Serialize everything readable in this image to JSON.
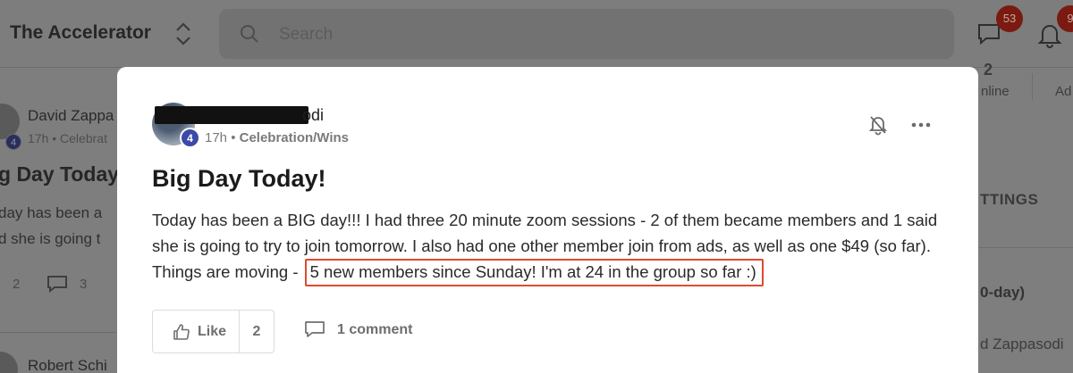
{
  "app": {
    "title": "The Accelerator"
  },
  "search": {
    "placeholder": "Search"
  },
  "header": {
    "chat_badge": "53",
    "notif_badge": "9"
  },
  "background_feed": {
    "post1": {
      "author": "David Zappa",
      "level": "4",
      "meta": "17h • Celebrat",
      "title": "g Day Today!",
      "body_lines": [
        "day has been a",
        "d she is going t"
      ],
      "likes": "2",
      "comments": "3"
    },
    "post2": {
      "author": "Robert Schi"
    }
  },
  "right_sidebar": {
    "stat_value": "2",
    "online_label": "nline",
    "admin_label": "Ad",
    "settings_label": "TTINGS",
    "challenge_label": "0-day)",
    "author_label": "d Zappasodi"
  },
  "post": {
    "author_suffix": "odi",
    "level": "4",
    "time": "17h",
    "category": "Celebration/Wins",
    "title": "Big Day Today!",
    "body_plain": "Today has been a BIG day!!! I had three 20 minute zoom sessions - 2 of them became members and 1 said she is going to try to join tomorrow. I also had one other member join from ads, as well as one $49 (so far). Things are moving -",
    "body_highlight": "5 new members since Sunday! I'm at 24 in the group so far :)",
    "highlight_color": "#e04a2f",
    "like_label": "Like",
    "like_count": "2",
    "comment_label": "1 comment"
  }
}
